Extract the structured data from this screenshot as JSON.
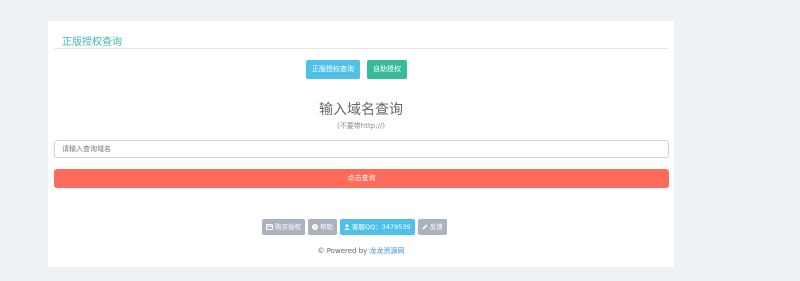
{
  "panel": {
    "title": "正版授权查询"
  },
  "top_buttons": {
    "official_query": "正版授权查询",
    "self_service": "自助授权"
  },
  "main": {
    "heading": "输入域名查询",
    "subheading": "(不要带http://)",
    "input_placeholder": "请输入查询域名",
    "input_value": "",
    "submit_label": "点击查询"
  },
  "footer_buttons": [
    {
      "label": "购买授权",
      "icon": "card-icon"
    },
    {
      "label": "帮助",
      "icon": "question-circle-icon"
    },
    {
      "label": "客服QQ：3479539",
      "icon": "user-icon"
    },
    {
      "label": "反馈",
      "icon": "pencil-icon"
    }
  ],
  "copyright": {
    "prefix": "© Powered by ",
    "link": "龙龙资源网"
  },
  "colors": {
    "background": "#eff2f5",
    "title": "#3fb8af",
    "blue_button": "#4fc1e9",
    "green_button": "#37bc9b",
    "red_button": "#fd6c5b",
    "gray_button": "#aab2bd"
  }
}
